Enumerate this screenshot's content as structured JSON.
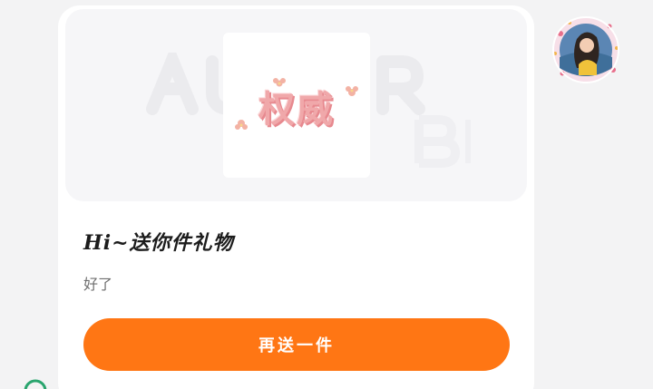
{
  "gift_card": {
    "gift_name": "权威",
    "title": "Hi~送你件礼物",
    "subtitle": "好了",
    "resend_label": "再送一件"
  },
  "colors": {
    "page_background": "#f3f3f4",
    "card_background": "#ffffff",
    "preview_background": "#f6f6f8",
    "button": "#ff7614",
    "gift_text": "#f0a8aa",
    "corner_icon": "#2aa56e"
  },
  "icons": {
    "avatar": "sender-avatar",
    "corner": "status-icon"
  }
}
